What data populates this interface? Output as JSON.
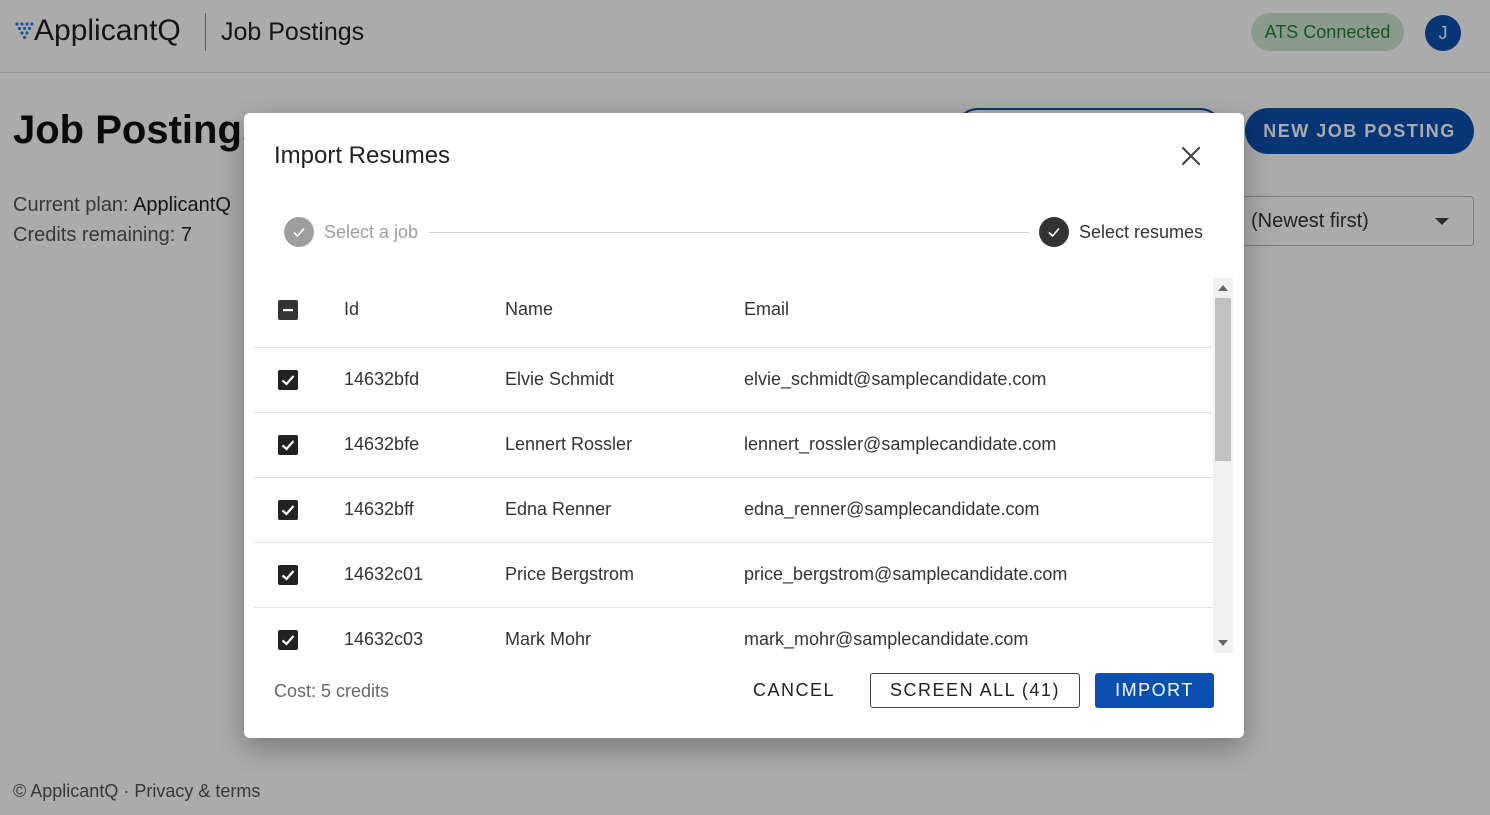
{
  "header": {
    "logo_text": "ApplicantQ",
    "section_title": "Job Postings",
    "ats_status": "ATS Connected",
    "avatar_initial": "J"
  },
  "page": {
    "title": "Job Postings",
    "plan_label": "Current plan: ",
    "plan_value": "ApplicantQ",
    "credits_label": "Credits remaining: ",
    "credits_value": "7",
    "new_job_button": "NEW JOB POSTING",
    "sort_value": "(Newest first)"
  },
  "footer": {
    "text": "© ApplicantQ · Privacy & terms"
  },
  "modal": {
    "title": "Import Resumes",
    "steps": [
      {
        "label": "Select a job",
        "state": "completed"
      },
      {
        "label": "Select resumes",
        "state": "active"
      }
    ],
    "table": {
      "columns": [
        "Id",
        "Name",
        "Email"
      ],
      "select_all_state": "indeterminate",
      "rows": [
        {
          "id": "14632bfd",
          "name": "Elvie Schmidt",
          "email": "elvie_schmidt@samplecandidate.com",
          "checked": true
        },
        {
          "id": "14632bfe",
          "name": "Lennert Rossler",
          "email": "lennert_rossler@samplecandidate.com",
          "checked": true
        },
        {
          "id": "14632bff",
          "name": "Edna Renner",
          "email": "edna_renner@samplecandidate.com",
          "checked": true
        },
        {
          "id": "14632c01",
          "name": "Price Bergstrom",
          "email": "price_bergstrom@samplecandidate.com",
          "checked": true
        },
        {
          "id": "14632c03",
          "name": "Mark Mohr",
          "email": "mark_mohr@samplecandidate.com",
          "checked": true
        }
      ]
    },
    "cost_text": "Cost: 5 credits",
    "cancel_label": "CANCEL",
    "screen_all_label": "SCREEN ALL (41)",
    "import_label": "IMPORT"
  },
  "colors": {
    "primary": "#0b4fb0",
    "ats_badge_bg": "#cfe8d0",
    "ats_badge_text": "#2f7a33",
    "step_completed": "#9e9e9e",
    "step_active": "#333333"
  }
}
